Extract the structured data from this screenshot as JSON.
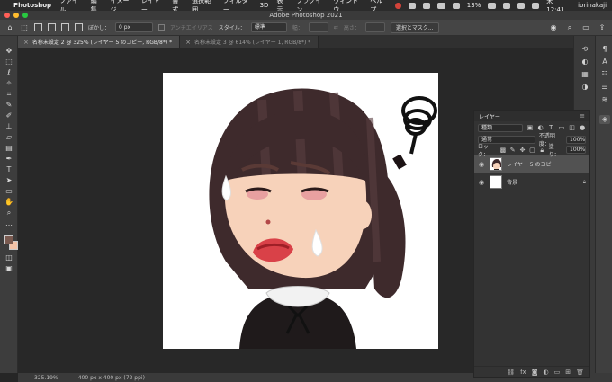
{
  "menubar": {
    "app_name": "Photoshop",
    "items": [
      "ファイル",
      "編集",
      "イメージ",
      "レイヤー",
      "書式",
      "選択範囲",
      "フィルター",
      "3D",
      "表示",
      "プラグイン",
      "ウィンドウ",
      "ヘルプ"
    ],
    "battery": "13%",
    "clock": "木 12:41",
    "user": "iorinakaji"
  },
  "window": {
    "title": "Adobe Photoshop 2021"
  },
  "options": {
    "feather_label": "ぼかし：",
    "feather_value": "0 px",
    "antialias_label": "アンチエイリアス",
    "style_label": "スタイル：",
    "style_value": "標準",
    "width_label": "幅：",
    "height_label": "高さ：",
    "select_mask_button": "選択とマスク..."
  },
  "tabs": [
    {
      "label": "名称未設定 2 @ 325% (レイヤー 5 のコピー, RGB/8*) *",
      "active": true
    },
    {
      "label": "名称未設定 3 @ 614% (レイヤー 1, RGB/8*) *",
      "active": false
    }
  ],
  "status": {
    "zoom": "325.19%",
    "doc_info": "400 px x 400 px (72 ppi)"
  },
  "layers_panel": {
    "title": "レイヤー",
    "filter_value": "種類",
    "blend_mode": "通常",
    "opacity_label": "不透明度：",
    "opacity_value": "100%",
    "lock_label": "ロック：",
    "fill_label": "塗り：",
    "fill_value": "100%",
    "layers": [
      {
        "name": "レイヤー 5 のコピー",
        "selected": true
      },
      {
        "name": "背景",
        "selected": false
      }
    ]
  },
  "colors": {
    "foreground": "#7a5a50",
    "background": "#f3c3a8",
    "accent_red": "#ff5f57",
    "accent_yellow": "#febc2e",
    "accent_green": "#28c840"
  },
  "icons": {
    "tools": [
      "move-icon",
      "marquee-icon",
      "lasso-icon",
      "magic-wand-icon",
      "crop-icon",
      "eyedropper-icon",
      "brush-icon",
      "stamp-icon",
      "eraser-icon",
      "gradient-icon",
      "pen-icon",
      "text-icon",
      "path-select-icon",
      "shape-icon",
      "hand-icon",
      "zoom-icon",
      "more-icon"
    ]
  }
}
